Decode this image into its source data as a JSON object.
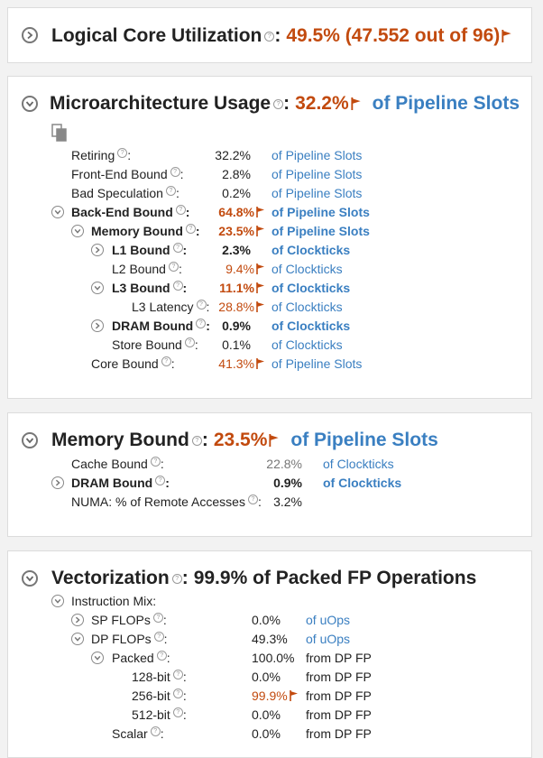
{
  "panels": {
    "core": {
      "title": "Logical Core Utilization",
      "sep": ":",
      "value": "49.5% (47.552 out of 96)"
    },
    "micro": {
      "title": "Microarchitecture Usage",
      "sep": ":",
      "value": "32.2%",
      "unit": "of Pipeline Slots",
      "rows": [
        {
          "label": "Retiring",
          "value": "32.2%",
          "unit": "of Pipeline Slots"
        },
        {
          "label": "Front-End Bound",
          "value": "2.8%",
          "unit": "of Pipeline Slots"
        },
        {
          "label": "Bad Speculation",
          "value": "0.2%",
          "unit": "of Pipeline Slots"
        },
        {
          "label": "Back-End Bound",
          "value": "64.8%",
          "unit": "of Pipeline Slots"
        },
        {
          "label": "Memory Bound",
          "value": "23.5%",
          "unit": "of Pipeline Slots"
        },
        {
          "label": "L1 Bound",
          "value": "2.3%",
          "unit": "of Clockticks"
        },
        {
          "label": "L2 Bound",
          "value": "9.4%",
          "unit": "of Clockticks"
        },
        {
          "label": "L3 Bound",
          "value": "11.1%",
          "unit": "of Clockticks"
        },
        {
          "label": "L3 Latency",
          "value": "28.8%",
          "unit": "of Clockticks"
        },
        {
          "label": "DRAM Bound",
          "value": "0.9%",
          "unit": "of Clockticks"
        },
        {
          "label": "Store Bound",
          "value": "0.1%",
          "unit": "of Clockticks"
        },
        {
          "label": "Core Bound",
          "value": "41.3%",
          "unit": "of Pipeline Slots"
        }
      ]
    },
    "memory": {
      "title": "Memory Bound",
      "sep": ":",
      "value": "23.5%",
      "unit": "of Pipeline Slots",
      "rows": [
        {
          "label": "Cache Bound",
          "value": "22.8%",
          "unit": "of Clockticks"
        },
        {
          "label": "DRAM Bound",
          "value": "0.9%",
          "unit": "of Clockticks"
        },
        {
          "label": "NUMA: % of Remote Accesses",
          "value": "3.2%",
          "unit": ""
        }
      ]
    },
    "vector": {
      "title": "Vectorization",
      "sep": ":",
      "value": "99.9% of Packed FP Operations",
      "rows": [
        {
          "label": "Instruction Mix:",
          "value": "",
          "unit": ""
        },
        {
          "label": "SP FLOPs",
          "value": "0.0%",
          "unit": "of uOps"
        },
        {
          "label": "DP FLOPs",
          "value": "49.3%",
          "unit": "of uOps"
        },
        {
          "label": "Packed",
          "value": "100.0%",
          "unit": "from DP FP"
        },
        {
          "label": "128-bit",
          "value": "0.0%",
          "unit": "from DP FP"
        },
        {
          "label": "256-bit",
          "value": "99.9%",
          "unit": "from DP FP"
        },
        {
          "label": "512-bit",
          "value": "0.0%",
          "unit": "from DP FP"
        },
        {
          "label": "Scalar",
          "value": "0.0%",
          "unit": "from DP FP"
        }
      ]
    }
  },
  "colors": {
    "highlight": "#c24a0e",
    "link": "#3a7fc1"
  },
  "icons": {
    "help": "question-circle-icon",
    "flag": "flag-icon",
    "copy": "copy-icon",
    "expand": "chevron-right-icon",
    "collapse": "chevron-down-icon"
  }
}
